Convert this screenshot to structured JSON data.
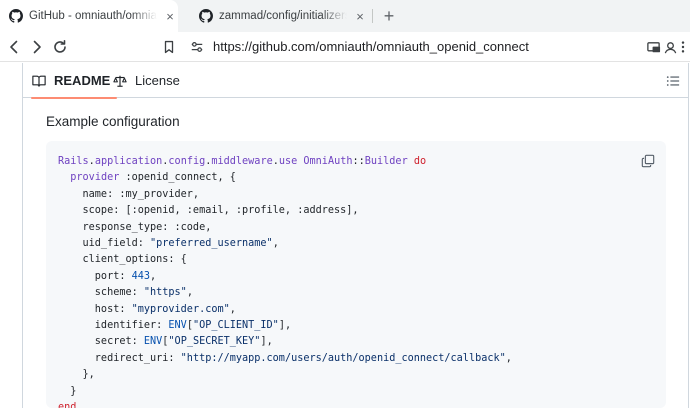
{
  "browser": {
    "tabs": [
      {
        "title": "GitHub - omniauth/omniauth_openid_connect",
        "active": true
      },
      {
        "title": "zammad/config/initializers/omniauth",
        "active": false
      }
    ],
    "close_glyph": "×",
    "new_tab_glyph": "+",
    "url": "https://github.com/omniauth/omniauth_openid_connect"
  },
  "readme": {
    "tabs": {
      "readme": "README",
      "license": "License"
    },
    "section_heading": "Example configuration"
  },
  "code": {
    "lines": [
      [
        [
          "c",
          "Rails"
        ],
        [
          "t",
          "."
        ],
        [
          "c",
          "application"
        ],
        [
          "t",
          "."
        ],
        [
          "c",
          "config"
        ],
        [
          "t",
          "."
        ],
        [
          "c",
          "middleware"
        ],
        [
          "t",
          "."
        ],
        [
          "c",
          "use"
        ],
        [
          "t",
          " "
        ],
        [
          "c",
          "OmniAuth"
        ],
        [
          "t",
          "::"
        ],
        [
          "c",
          "Builder"
        ],
        [
          "t",
          " "
        ],
        [
          "k",
          "do"
        ]
      ],
      [
        [
          "t",
          "  "
        ],
        [
          "c",
          "provider"
        ],
        [
          "t",
          " :openid_connect, {"
        ]
      ],
      [
        [
          "t",
          "    name: :my_provider,"
        ]
      ],
      [
        [
          "t",
          "    scope: [:openid, :email, :profile, :address],"
        ]
      ],
      [
        [
          "t",
          "    response_type: :code,"
        ]
      ],
      [
        [
          "t",
          "    uid_field: "
        ],
        [
          "s",
          "\"preferred_username\""
        ],
        [
          "t",
          ","
        ]
      ],
      [
        [
          "t",
          "    client_options: {"
        ]
      ],
      [
        [
          "t",
          "      port: "
        ],
        [
          "n",
          "443"
        ],
        [
          "t",
          ","
        ]
      ],
      [
        [
          "t",
          "      scheme: "
        ],
        [
          "s",
          "\"https\""
        ],
        [
          "t",
          ","
        ]
      ],
      [
        [
          "t",
          "      host: "
        ],
        [
          "s",
          "\"myprovider.com\""
        ],
        [
          "t",
          ","
        ]
      ],
      [
        [
          "t",
          "      identifier: "
        ],
        [
          "n",
          "ENV"
        ],
        [
          "t",
          "["
        ],
        [
          "s",
          "\"OP_CLIENT_ID\""
        ],
        [
          "t",
          "],"
        ]
      ],
      [
        [
          "t",
          "      secret: "
        ],
        [
          "n",
          "ENV"
        ],
        [
          "t",
          "["
        ],
        [
          "s",
          "\"OP_SECRET_KEY\""
        ],
        [
          "t",
          "],"
        ]
      ],
      [
        [
          "t",
          "      redirect_uri: "
        ],
        [
          "s",
          "\"http://myapp.com/users/auth/openid_connect/callback\""
        ],
        [
          "t",
          ","
        ]
      ],
      [
        [
          "t",
          "    },"
        ]
      ],
      [
        [
          "t",
          "  }"
        ]
      ],
      [
        [
          "k",
          "end"
        ]
      ]
    ]
  },
  "icons": {
    "tab_favicon": "github-icon",
    "back": "arrow-left-icon",
    "forward": "arrow-right-icon",
    "reload": "reload-icon",
    "bookmark": "bookmark-icon",
    "site_info": "tune-icon",
    "cast": "cast-icon",
    "profile": "profile-icon",
    "menu": "kebab-menu-icon",
    "readme": "book-icon",
    "license": "law-icon",
    "outline": "list-icon",
    "copy": "copy-icon"
  },
  "colors": {
    "accent_tab_underline": "#fd8c73",
    "code_background": "#f6f8fa",
    "code_constant": "#6f42c1",
    "code_keyword": "#cf222e",
    "code_string": "#0a3069",
    "code_number": "#0550ae"
  }
}
